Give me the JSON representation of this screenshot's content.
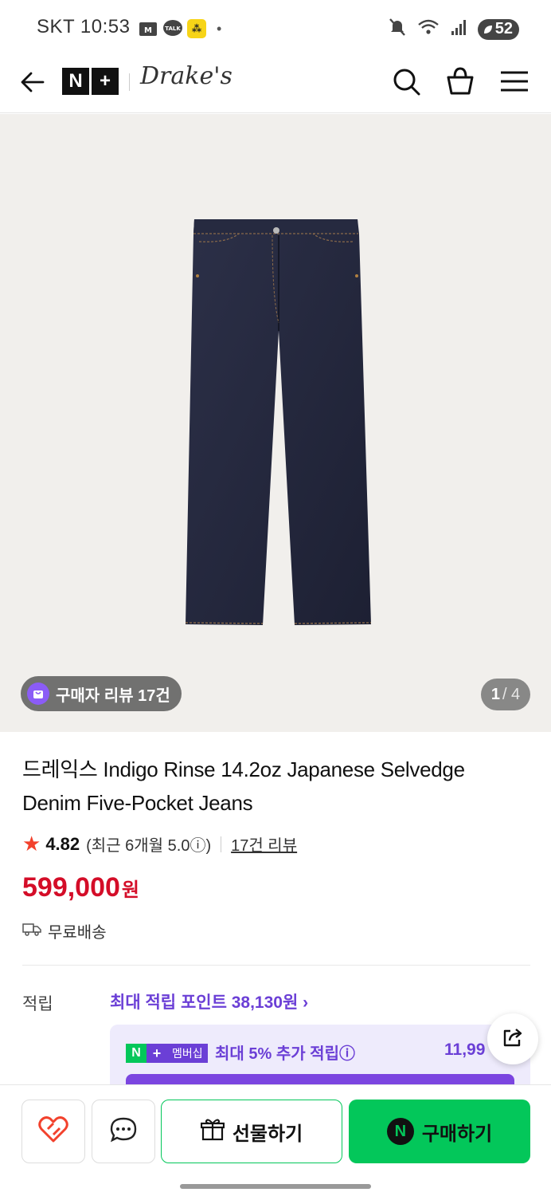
{
  "status_bar": {
    "carrier_time": "SKT 10:53",
    "notif_talk": "TALK",
    "notif_dot": "•",
    "battery": "52"
  },
  "header": {
    "logo_n": "N",
    "logo_plus": "+",
    "brand": "Drake's"
  },
  "hero": {
    "review_chip": "구매자 리뷰 17건",
    "page_current": "1",
    "page_total": "/ 4"
  },
  "product": {
    "title": "드레익스 Indigo Rinse 14.2oz Japanese Selvedge Denim Five-Pocket Jeans",
    "rating_score": "4.82",
    "rating_recent": "(최근 6개월 5.0ⓘ)",
    "review_link": "17건 리뷰",
    "price": "599,000",
    "price_unit": "원",
    "shipping": "무료배송"
  },
  "points": {
    "label": "적립",
    "max_link": "최대 적립 포인트 38,130원 ›",
    "badge_n": "N",
    "badge_plus": "+",
    "badge_text": "멤버십",
    "member_text": "최대 5% 추가 적립ⓘ",
    "member_amount": "11,99"
  },
  "bottom_bar": {
    "gift_label": "선물하기",
    "buy_label": "구매하기",
    "npay": "N"
  },
  "colors": {
    "accent_green": "#03c75a",
    "price_red": "#d40d28",
    "purple": "#6b3fd6",
    "star": "#f2412c"
  }
}
